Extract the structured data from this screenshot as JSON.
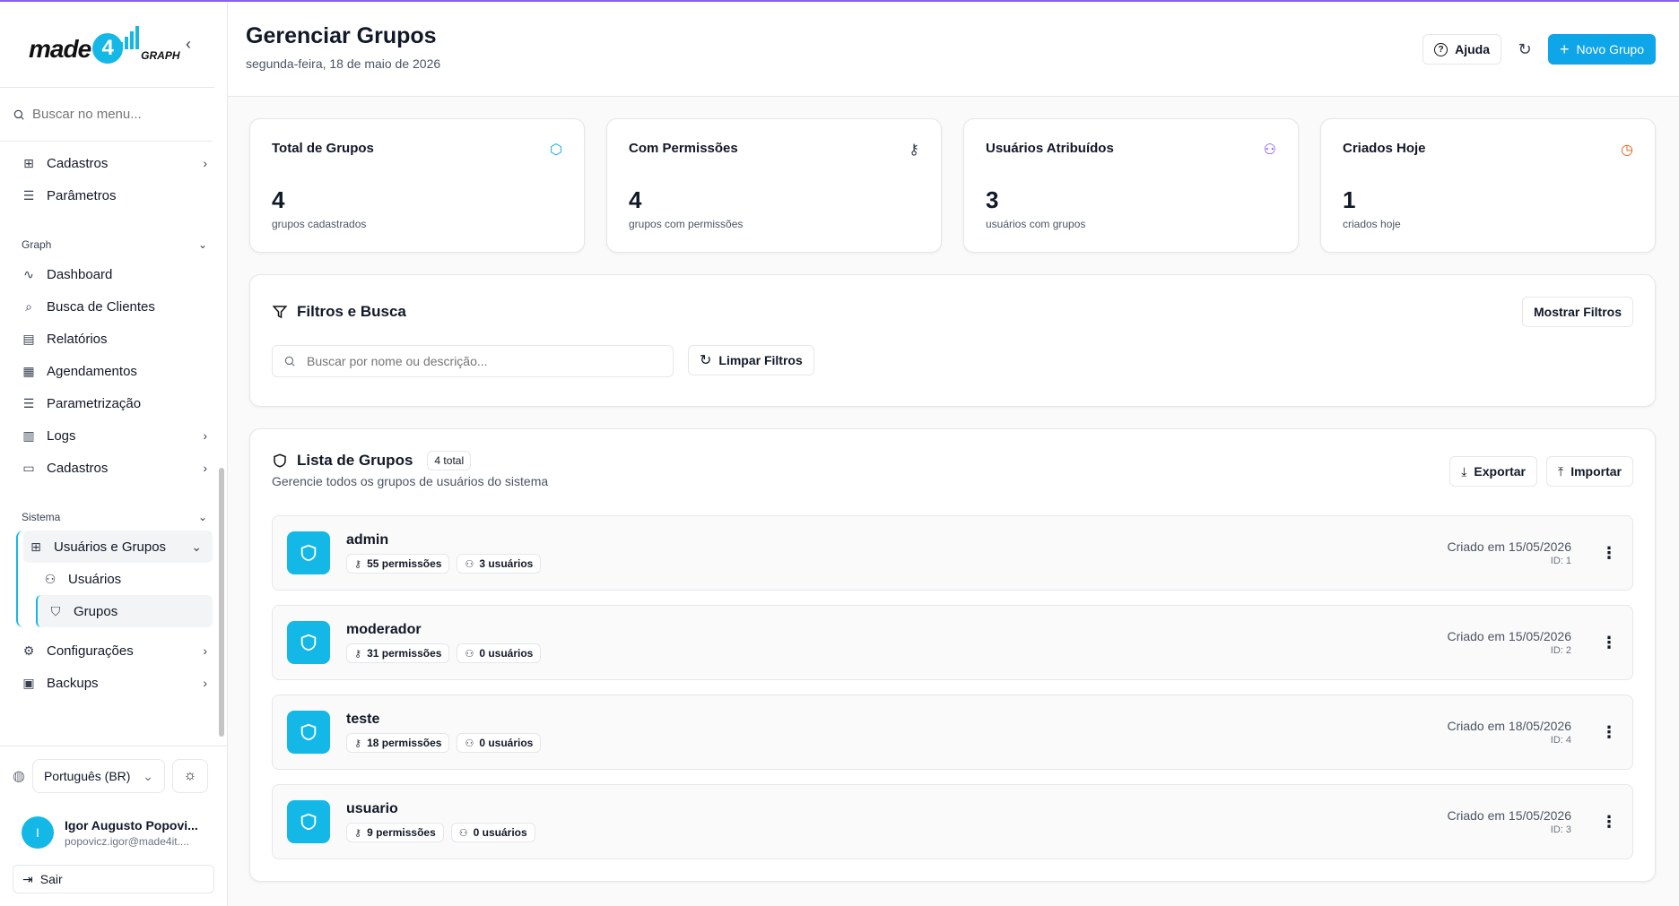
{
  "logo": {
    "made": "made",
    "four": "4",
    "graph": "GRAPH"
  },
  "sidebar": {
    "search_placeholder": "Buscar no menu...",
    "top_items": [
      {
        "label": "Cadastros",
        "icon": "grid-icon"
      },
      {
        "label": "Parâmetros",
        "icon": "sliders-icon"
      }
    ],
    "graph_section": "Graph",
    "graph_items": [
      {
        "label": "Dashboard"
      },
      {
        "label": "Busca de Clientes"
      },
      {
        "label": "Relatórios"
      },
      {
        "label": "Agendamentos"
      },
      {
        "label": "Parametrização"
      },
      {
        "label": "Logs"
      },
      {
        "label": "Cadastros"
      }
    ],
    "sistema_section": "Sistema",
    "usuarios_grupos": "Usuários e Grupos",
    "usuarios": "Usuários",
    "grupos": "Grupos",
    "configuracoes": "Configurações",
    "backups": "Backups",
    "language": "Português (BR)",
    "user": {
      "initial": "I",
      "name": "Igor Augusto Popovi...",
      "email": "popovicz.igor@made4it...."
    },
    "logout": "Sair"
  },
  "header": {
    "title": "Gerenciar Grupos",
    "date": "segunda-feira, 18 de maio de 2026",
    "help": "Ajuda",
    "new_group": "Novo Grupo"
  },
  "stats": [
    {
      "label": "Total de Grupos",
      "value": "4",
      "sub": "grupos cadastrados",
      "color": "#0ea5e9"
    },
    {
      "label": "Com Permissões",
      "value": "4",
      "sub": "grupos com permissões",
      "color": "#374151"
    },
    {
      "label": "Usuários Atribuídos",
      "value": "3",
      "sub": "usuários com grupos",
      "color": "#7c3aed"
    },
    {
      "label": "Criados Hoje",
      "value": "1",
      "sub": "criados hoje",
      "color": "#ea580c"
    }
  ],
  "filters": {
    "title": "Filtros e Busca",
    "show_filters": "Mostrar Filtros",
    "search_placeholder": "Buscar por nome ou descrição...",
    "clear": "Limpar Filtros"
  },
  "list": {
    "title": "Lista de Grupos",
    "total": "4 total",
    "subtitle": "Gerencie todos os grupos de usuários do sistema",
    "export": "Exportar",
    "import": "Importar",
    "rows": [
      {
        "name": "admin",
        "permissions": "55 permissões",
        "users": "3 usuários",
        "created": "Criado em 15/05/2026",
        "id": "ID: 1"
      },
      {
        "name": "moderador",
        "permissions": "31 permissões",
        "users": "0 usuários",
        "created": "Criado em 15/05/2026",
        "id": "ID: 2"
      },
      {
        "name": "teste",
        "permissions": "18 permissões",
        "users": "0 usuários",
        "created": "Criado em 18/05/2026",
        "id": "ID: 4"
      },
      {
        "name": "usuario",
        "permissions": "9 permissões",
        "users": "0 usuários",
        "created": "Criado em 15/05/2026",
        "id": "ID: 3"
      }
    ]
  },
  "colors": {
    "accent": "#0ea5e9",
    "brand": "#14b8e6"
  }
}
